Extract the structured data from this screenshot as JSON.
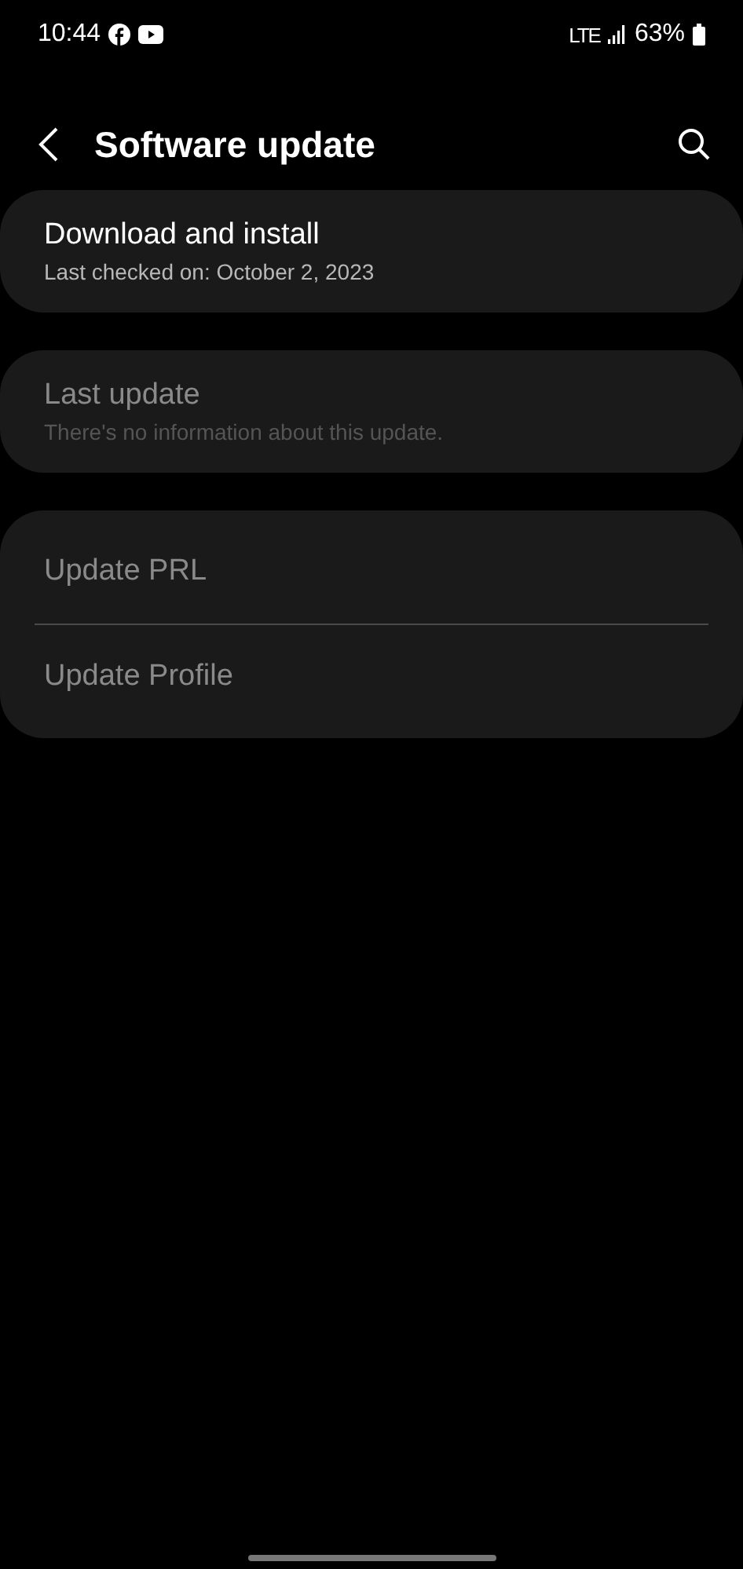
{
  "status_bar": {
    "time": "10:44",
    "network": "LTE",
    "battery": "63%"
  },
  "app_bar": {
    "title": "Software update"
  },
  "groups": [
    {
      "items": [
        {
          "title": "Download and install",
          "subtitle": "Last checked on: October 2, 2023",
          "disabled": false
        }
      ]
    },
    {
      "items": [
        {
          "title": "Last update",
          "subtitle": "There's no information about this update.",
          "disabled": true
        }
      ]
    },
    {
      "items": [
        {
          "title": "Update PRL",
          "disabled": true
        },
        {
          "title": "Update Profile",
          "disabled": true
        }
      ]
    }
  ]
}
